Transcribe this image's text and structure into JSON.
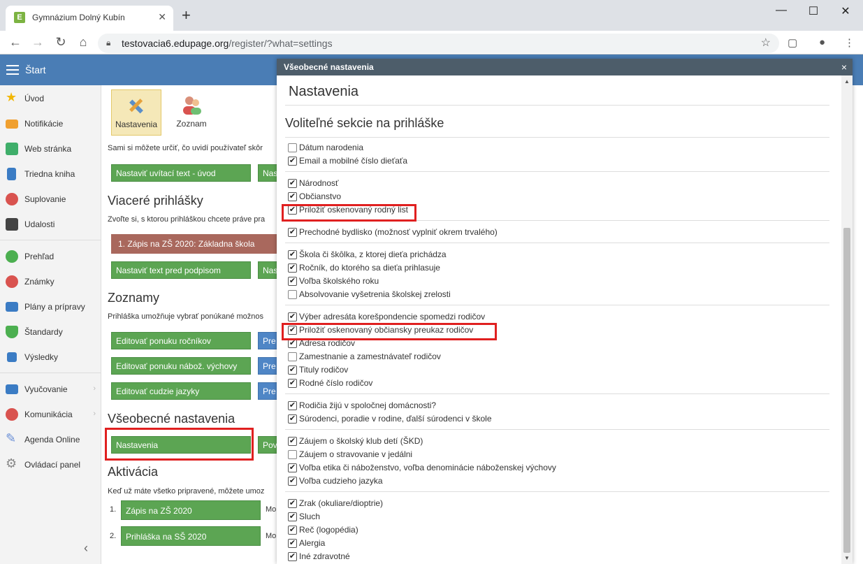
{
  "browser": {
    "tab_title": "Gymnázium Dolný Kubín",
    "favicon": "E",
    "url_host": "testovacia6.edupage.org",
    "url_path": "/register/?what=settings",
    "win_min": "—",
    "win_max": "☐",
    "win_close": "✕",
    "new_tab": "+"
  },
  "header": {
    "start_label": "Štart"
  },
  "sidebar": {
    "items": [
      {
        "label": "Úvod",
        "icon": "star-icon",
        "color": "#f2b705"
      },
      {
        "label": "Notifikácie",
        "icon": "mail-icon",
        "color": "#f0a030"
      },
      {
        "label": "Web stránka",
        "icon": "home-icon",
        "color": "#3fae6a"
      },
      {
        "label": "Triedna kniha",
        "icon": "book-icon",
        "color": "#3b7cc4"
      },
      {
        "label": "Suplovanie",
        "icon": "person-icon",
        "color": "#d9534f"
      },
      {
        "label": "Udalosti",
        "icon": "calendar-icon",
        "color": "#444444"
      },
      {
        "label": "Prehľad",
        "icon": "check-circle-icon",
        "color": "#4caf50"
      },
      {
        "label": "Známky",
        "icon": "grade-icon",
        "color": "#d9534f"
      },
      {
        "label": "Plány a prípravy",
        "icon": "briefcase-icon",
        "color": "#3b7cc4"
      },
      {
        "label": "Štandardy",
        "icon": "shield-icon",
        "color": "#4caf50"
      },
      {
        "label": "Výsledky",
        "icon": "bar-chart-icon",
        "color": "#3b7cc4"
      },
      {
        "label": "Vyučovanie",
        "icon": "open-book-icon",
        "color": "#3b7cc4"
      },
      {
        "label": "Komunikácia",
        "icon": "chat-icon",
        "color": "#d9534f"
      },
      {
        "label": "Agenda Online",
        "icon": "pen-icon",
        "color": "#6a8fd6"
      },
      {
        "label": "Ovládací panel",
        "icon": "gear-icon",
        "color": "#888888"
      }
    ],
    "collapse": "‹"
  },
  "main": {
    "toolbar": [
      {
        "label": "Nastavenia"
      },
      {
        "label": "Zoznam"
      }
    ],
    "intro_text": "Sami si môžete určiť, čo uvidí používateľ skôr",
    "btn_welcome": "Nastaviť uvítací text - úvod",
    "btn_welcome_side": "Nas",
    "h_multi": "Viaceré prihlášky",
    "multi_text": "Zvoľte si, s ktorou prihláškou chcete práve pra",
    "btn_reg1": "1. Zápis na ZŠ 2020: Základna škola",
    "btn_sign": "Nastaviť text pred podpisom",
    "btn_sign_side": "Nas",
    "h_lists": "Zoznamy",
    "lists_text": "Prihláška umožňuje vybrať ponúkané možnos",
    "btn_grades": "Editovať ponuku ročníkov",
    "btn_religion": "Editovať ponuku nábož. výchovy",
    "btn_lang": "Editovať cudzie jazyky",
    "side_pre": "Pre",
    "h_general": "Všeobecné nastavenia",
    "btn_settings": "Nastavenia",
    "btn_settings_side": "Pov",
    "h_activation": "Aktivácia",
    "activation_text": "Keď už máte všetko pripravené, môžete umoz",
    "act_items": [
      {
        "num": "1.",
        "label": "Zápis na ZŠ 2020",
        "side": "Mo"
      },
      {
        "num": "2.",
        "label": "Prihláška na SŠ 2020",
        "side": "Mo"
      }
    ]
  },
  "dialog": {
    "title": "Všeobecné nastavenia",
    "close": "×",
    "h1": "Nastavenia",
    "h2": "Voliteľné sekcie na prihláške",
    "groups": [
      [
        {
          "label": "Dátum narodenia",
          "checked": false
        },
        {
          "label": "Email a mobilné číslo dieťaťa",
          "checked": true
        }
      ],
      [
        {
          "label": "Národnosť",
          "checked": true
        },
        {
          "label": "Občianstvo",
          "checked": true
        },
        {
          "label": "Priložiť oskenovaný rodný list",
          "checked": true
        }
      ],
      [
        {
          "label": "Prechodné bydlisko (možnosť vyplniť okrem trvalého)",
          "checked": true
        }
      ],
      [
        {
          "label": "Škola či škôlka, z ktorej dieťa prichádza",
          "checked": true
        },
        {
          "label": "Ročník, do ktorého sa dieťa prihlasuje",
          "checked": true
        },
        {
          "label": "Voľba školského roku",
          "checked": true
        },
        {
          "label": "Absolvovanie vyšetrenia školskej zrelosti",
          "checked": false
        }
      ],
      [
        {
          "label": "Výber adresáta korešpondencie spomedzi rodičov",
          "checked": true
        },
        {
          "label": "Priložiť oskenovaný občiansky preukaz rodičov",
          "checked": true
        },
        {
          "label": "Adresa rodičov",
          "checked": true
        },
        {
          "label": "Zamestnanie a zamestnávateľ rodičov",
          "checked": false
        },
        {
          "label": "Tituly rodičov",
          "checked": true
        },
        {
          "label": "Rodné číslo rodičov",
          "checked": true
        }
      ],
      [
        {
          "label": "Rodičia žijú v spoločnej domácnosti?",
          "checked": true
        },
        {
          "label": "Súrodenci, poradie v rodine, ďalší súrodenci v škole",
          "checked": true
        }
      ],
      [
        {
          "label": "Záujem o školský klub detí (ŠKD)",
          "checked": true
        },
        {
          "label": "Záujem o stravovanie v jedálni",
          "checked": false
        },
        {
          "label": "Voľba etika či náboženstvo, voľba denominácie náboženskej výchovy",
          "checked": true
        },
        {
          "label": "Voľba cudzieho jazyka",
          "checked": true
        }
      ],
      [
        {
          "label": "Zrak (okuliare/dioptrie)",
          "checked": true
        },
        {
          "label": "Sluch",
          "checked": true
        },
        {
          "label": "Reč (logopédia)",
          "checked": true
        },
        {
          "label": "Alergia",
          "checked": true
        },
        {
          "label": "Iné zdravotné",
          "checked": true
        }
      ]
    ]
  },
  "colors": {
    "accent_blue": "#4a7db5",
    "green_button": "#5ca553",
    "highlight_red": "#e02020"
  }
}
